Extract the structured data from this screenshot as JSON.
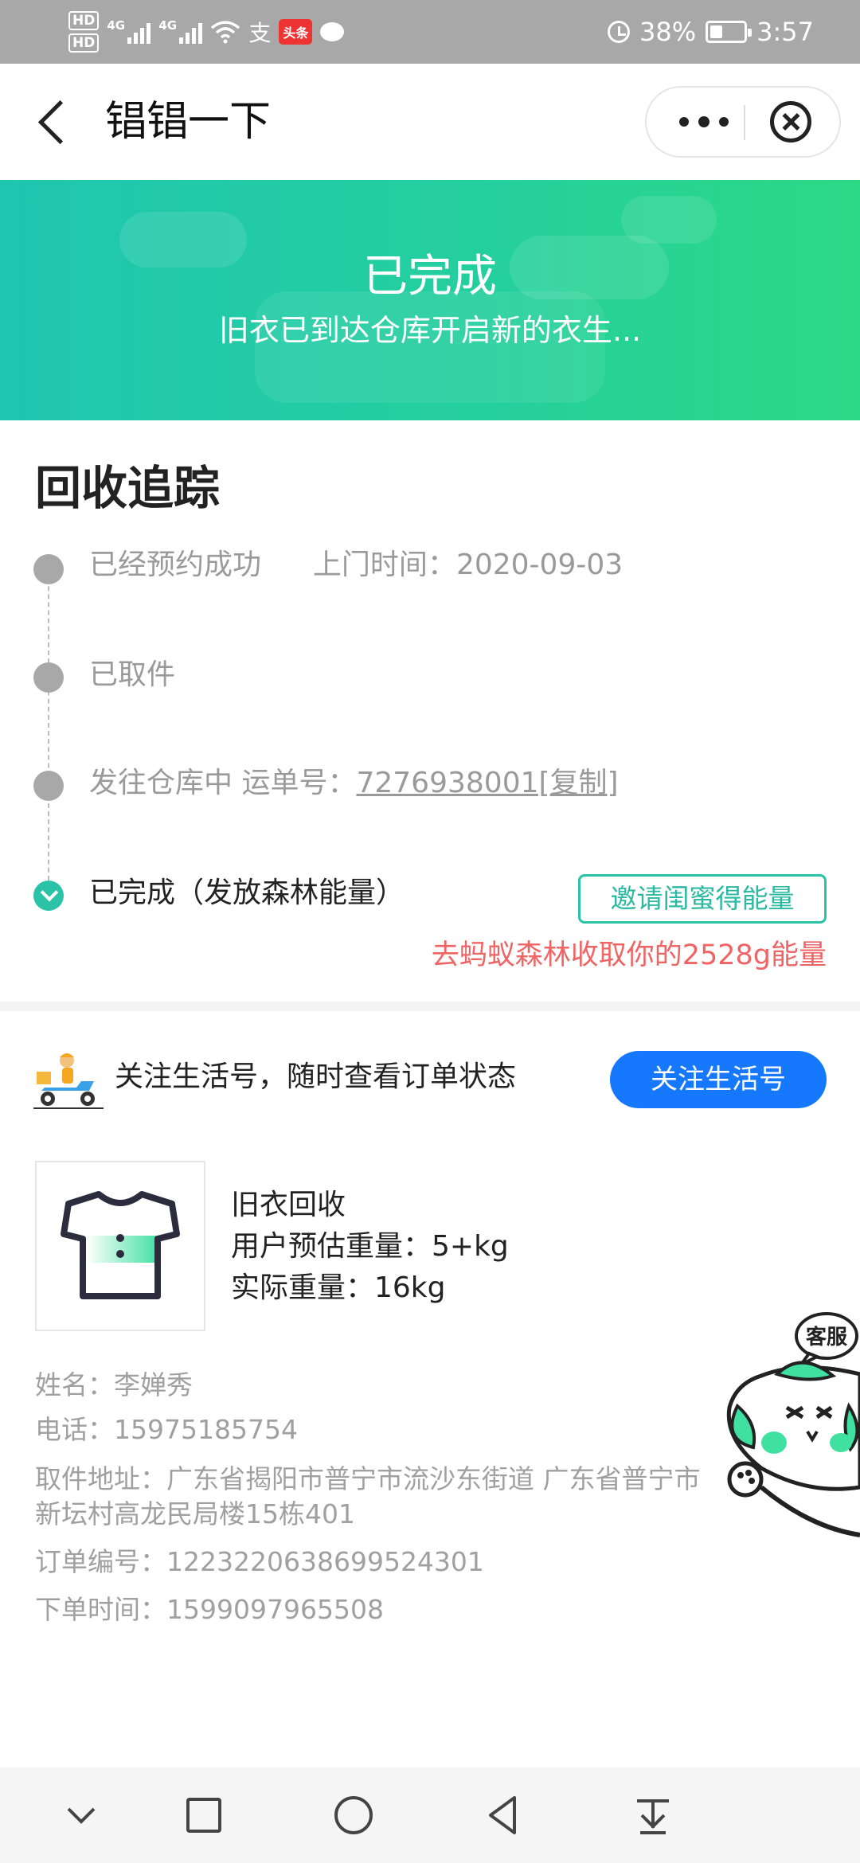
{
  "status_bar": {
    "hd_top": "HD",
    "hd_bottom": "HD",
    "net1": "4G",
    "net2": "4G",
    "alipay_glyph": "支",
    "toutiao": "头条",
    "battery": "38%",
    "time": "3:57",
    "battery_level": 0.38
  },
  "nav": {
    "title": "锠锠一下",
    "back_icon": "back-arrow-icon",
    "more_icon": "more-dots-icon",
    "close_icon": "close-circle-icon"
  },
  "banner": {
    "title": "已完成",
    "subtitle": "旧衣已到达仓库开启新的衣生..."
  },
  "tracking": {
    "title": "回收追踪",
    "steps": [
      {
        "label": "已经预约成功",
        "extra_label": "上门时间：",
        "extra_value": "2020-09-03"
      },
      {
        "label": "已取件"
      },
      {
        "label": "发往仓库中 运单号：",
        "waybill": "7276938001[复制]"
      },
      {
        "label": "已完成（发放森林能量）"
      }
    ],
    "invite_button": "邀请闺蜜得能量",
    "energy_tip": "去蚂蚁森林收取你的2528g能量"
  },
  "follow": {
    "text": "关注生活号，随时查看订单状态",
    "button": "关注生活号"
  },
  "product": {
    "name": "旧衣回收",
    "estimate": "用户预估重量：5+kg",
    "actual": "实际重量：16kg"
  },
  "order_info": {
    "name": "姓名：李婵秀",
    "phone": "电话：15975185754",
    "address_line1": "取件地址：广东省揭阳市普宁市流沙东街道 广东省普宁市",
    "address_line2": "新坛村高龙民局楼15栋401",
    "order_no": "订单编号：122322063869952430​1",
    "order_time": "下单时间：1599097965508"
  },
  "customer_service": {
    "label": "客服"
  },
  "colors": {
    "banner_start": "#1fc6b0",
    "banner_end": "#2cd985",
    "accent_teal": "#2bc3a8",
    "follow_blue": "#1678ff",
    "energy_red": "#ef6464"
  }
}
